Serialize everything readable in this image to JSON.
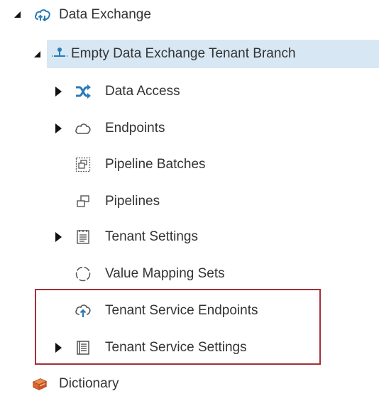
{
  "tree": {
    "root": {
      "label": "Data Exchange",
      "icon": "cloud-sync-icon",
      "expanded": true
    },
    "branch": {
      "label": "Empty Data Exchange Tenant Branch",
      "icon": "branch-icon",
      "expanded": true,
      "selected": true
    },
    "items": [
      {
        "label": "Data Access",
        "icon": "shuffle-icon",
        "expandable": true
      },
      {
        "label": "Endpoints",
        "icon": "cloud-outline-icon",
        "expandable": true
      },
      {
        "label": "Pipeline Batches",
        "icon": "pipeline-batches-icon",
        "expandable": false
      },
      {
        "label": "Pipelines",
        "icon": "pipelines-icon",
        "expandable": false
      },
      {
        "label": "Tenant Settings",
        "icon": "settings-document-icon",
        "expandable": true
      },
      {
        "label": "Value Mapping Sets",
        "icon": "dotted-circle-icon",
        "expandable": false
      },
      {
        "label": "Tenant Service Endpoints",
        "icon": "cloud-upload-icon",
        "expandable": false
      },
      {
        "label": "Tenant Service Settings",
        "icon": "service-document-icon",
        "expandable": true
      }
    ],
    "sibling": {
      "label": "Dictionary",
      "icon": "book-icon"
    }
  },
  "colors": {
    "selection_bg": "#d7e8f4",
    "highlight_border": "#a3313a",
    "icon_blue": "#2a7ab8",
    "book_orange": "#d9662e"
  }
}
